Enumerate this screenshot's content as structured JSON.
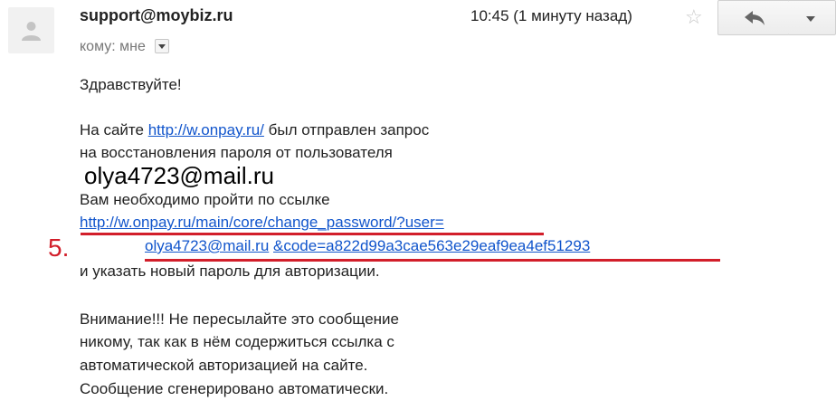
{
  "header": {
    "sender_email": "support@moybiz.ru",
    "recipient_label": "кому: мне",
    "time_text": "10:45 (1 минуту назад)",
    "star_icon": "star-outline-icon",
    "reply_icon": "reply-icon",
    "more_icon": "chevron-down-icon"
  },
  "message": {
    "greeting": "Здравствуйте!",
    "line1_prefix": "На сайте ",
    "site_link": "http://w.onpay.ru/",
    "line1_suffix": " был отправлен запрос",
    "line2": "на восстановления пароля от пользователя",
    "user_email": "olya4723@mail.ru",
    "line3": "Вам необходимо пройти по ссылке",
    "reset_link_part1": "http://w.onpay.ru/main/core/change_password/?user=",
    "reset_link_part2": "olya4723@mail.ru",
    "reset_link_part3": "&code=a822d99a3cae563e29eaf9ea4ef51293",
    "line4": "и указать новый пароль для авторизации.",
    "warning1": "Внимание!!! Не пересылайте это сообщение",
    "warning2": "никому, так как в нём содержиться ссылка с",
    "warning3": "автоматической авторизацией на сайте.",
    "warning4": "Сообщение сгенерировано автоматически."
  },
  "annotation": {
    "step_label": "5.",
    "accent_color": "#d21e2a"
  },
  "colors": {
    "link": "#1155cc",
    "text": "#222222"
  }
}
